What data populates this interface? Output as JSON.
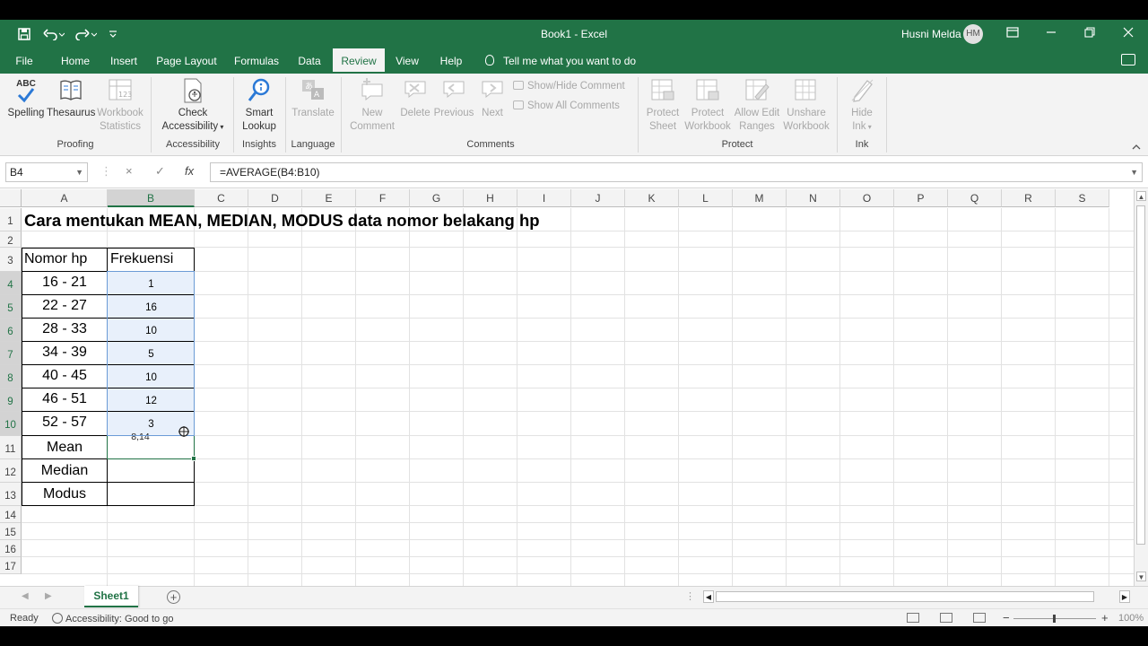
{
  "app": {
    "window_title": "Book1  -  Excel",
    "user_name": "Husni Melda",
    "user_initials": "HM",
    "accent": "#217346"
  },
  "quick_access": {
    "save_icon": "save-icon",
    "undo_icon": "undo-icon",
    "redo_icon": "redo-icon",
    "customize_icon": "customize-icon"
  },
  "tabs": [
    "File",
    "Home",
    "Insert",
    "Page Layout",
    "Formulas",
    "Data",
    "Review",
    "View",
    "Help"
  ],
  "active_tab": "Review",
  "tell_me": "Tell me what you want to do",
  "ribbon": {
    "proofing": {
      "label": "Proofing",
      "spelling_top": "ABC",
      "spelling": "Spelling",
      "thesaurus": "Thesaurus",
      "workbook_stats_1": "Workbook",
      "workbook_stats_2": "Statistics"
    },
    "accessibility": {
      "label": "Accessibility",
      "check_1": "Check",
      "check_2": "Accessibility"
    },
    "insights": {
      "label": "Insights",
      "smart_1": "Smart",
      "smart_2": "Lookup"
    },
    "language": {
      "label": "Language",
      "translate": "Translate"
    },
    "comments": {
      "label": "Comments",
      "new_1": "New",
      "new_2": "Comment",
      "delete": "Delete",
      "previous": "Previous",
      "next": "Next",
      "show_hide": "Show/Hide Comment",
      "show_all": "Show All Comments"
    },
    "protect": {
      "label": "Protect",
      "sheet_1": "Protect",
      "sheet_2": "Sheet",
      "wb_1": "Protect",
      "wb_2": "Workbook",
      "ranges_1": "Allow Edit",
      "ranges_2": "Ranges",
      "unshare_1": "Unshare",
      "unshare_2": "Workbook"
    },
    "ink": {
      "label": "Ink",
      "hide_1": "Hide",
      "hide_2": "Ink"
    }
  },
  "formula_bar": {
    "name_box": "B4",
    "cancel_icon": "×",
    "enter_icon": "✓",
    "fx": "fx",
    "formula": "=AVERAGE(B4:B10)"
  },
  "grid": {
    "columns": [
      "A",
      "B",
      "C",
      "D",
      "E",
      "F",
      "G",
      "H",
      "I",
      "J",
      "K",
      "L",
      "M",
      "N",
      "O",
      "P",
      "Q",
      "R",
      "S"
    ],
    "rows": [
      "1",
      "2",
      "3",
      "4",
      "5",
      "6",
      "7",
      "8",
      "9",
      "10",
      "11",
      "12",
      "13",
      "14",
      "15",
      "16",
      "17"
    ],
    "selected_column": "B",
    "title": "Cara mentukan MEAN, MEDIAN, MODUS data nomor belakang hp",
    "header_a": "Nomor hp",
    "header_b": "Frekuensi",
    "intervals": [
      "16 - 21",
      "22 - 27",
      "28 - 33",
      "34 - 39",
      "40 - 45",
      "46 - 51",
      "52 - 57"
    ],
    "frequencies": [
      "1",
      "16",
      "10",
      "5",
      "10",
      "12",
      "3"
    ],
    "stat_labels": [
      "Mean",
      "Median",
      "Modus"
    ],
    "mean_preview": "8,14"
  },
  "sheets": {
    "active": "Sheet1"
  },
  "status": {
    "ready": "Ready",
    "accessibility": "Accessibility: Good to go",
    "zoom": "100%"
  }
}
